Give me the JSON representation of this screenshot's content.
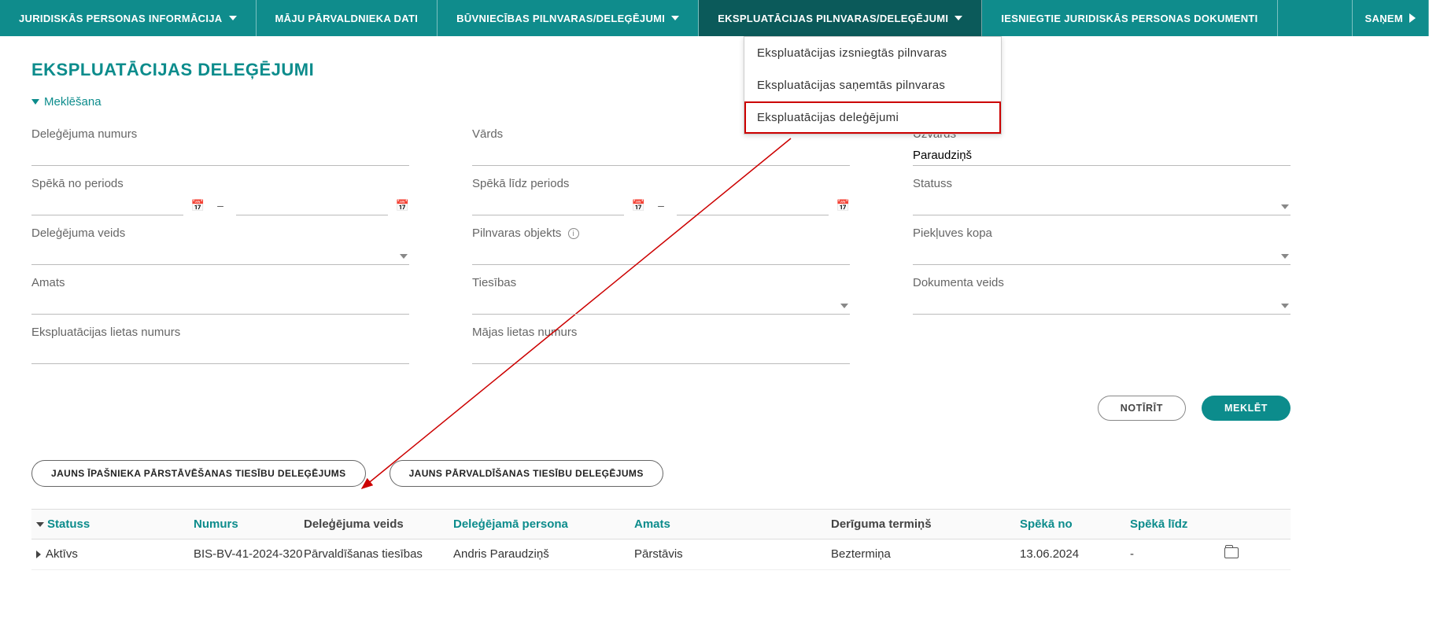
{
  "nav": {
    "items": [
      {
        "label": "Juridiskās personas informācija",
        "caret": true
      },
      {
        "label": "Māju pārvaldnieka dati",
        "caret": false
      },
      {
        "label": "Būvniecības pilnvaras/deleģējumi",
        "caret": true
      },
      {
        "label": "Ekspluatācijas pilnvaras/deleģējumi",
        "caret": true,
        "active": true
      },
      {
        "label": "Iesniegtie juridiskās personas dokumenti",
        "caret": false
      }
    ],
    "more": "Saņem"
  },
  "dropdown": {
    "items": [
      {
        "label": "Ekspluatācijas izsniegtās pilnvaras"
      },
      {
        "label": "Ekspluatācijas saņemtās pilnvaras"
      },
      {
        "label": "Ekspluatācijas deleģējumi",
        "highlighted": true
      }
    ]
  },
  "title": "Ekspluatācijas deleģējumi",
  "search_toggle": "Meklēšana",
  "fields": {
    "num": "Deleģējuma numurs",
    "vards": "Vārds",
    "uzvards": "Uzvārds",
    "uzvards_value": "Paraudziņš",
    "speka_no": "Spēkā no periods",
    "speka_lidz": "Spēkā līdz periods",
    "statuss": "Statuss",
    "veids": "Deleģējuma veids",
    "objekts": "Pilnvaras objekts",
    "kopa": "Piekļuves kopa",
    "amats": "Amats",
    "tiesibas": "Tiesības",
    "doc_veids": "Dokumenta veids",
    "ekspl_lieta": "Ekspluatācijas lietas numurs",
    "majas_lieta": "Mājas lietas numurs"
  },
  "buttons": {
    "clear": "Notīrīt",
    "search": "Meklēt",
    "new_owner": "Jauns īpašnieka pārstāvēšanas tiesību deleģējums",
    "new_mgmt": "Jauns pārvaldīšanas tiesību deleģējums"
  },
  "table": {
    "headers": {
      "status": "Statuss",
      "number": "Numurs",
      "veids": "Deleģējuma veids",
      "persona": "Deleģējamā persona",
      "amats": "Amats",
      "termins": "Derīguma termiņš",
      "speka_no": "Spēkā no",
      "speka_lidz": "Spēkā līdz"
    },
    "rows": [
      {
        "status": "Aktīvs",
        "number": "BIS-BV-41-2024-320",
        "veids": "Pārvaldīšanas tiesības",
        "persona": "Andris Paraudziņš",
        "amats": "Pārstāvis",
        "termins": "Beztermiņa",
        "speka_no": "13.06.2024",
        "speka_lidz": "-"
      }
    ]
  }
}
